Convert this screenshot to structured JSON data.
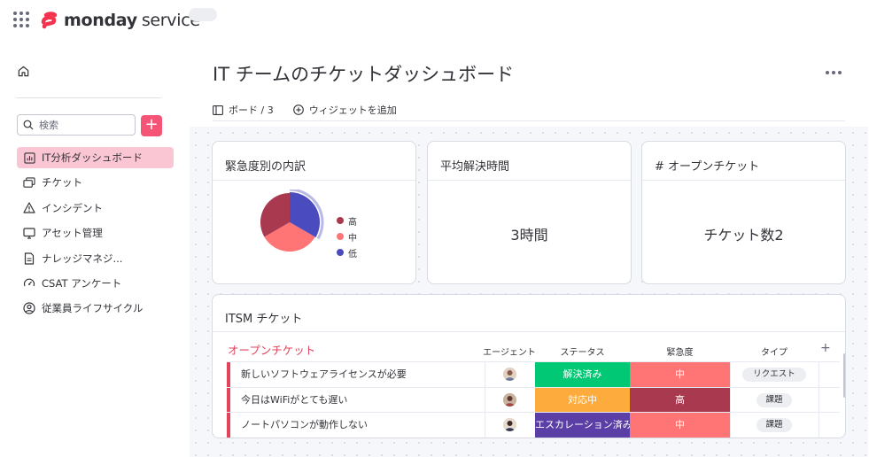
{
  "app": {
    "brand": "monday",
    "product": "service"
  },
  "sidebar": {
    "search_placeholder": "検索",
    "add_label": "+",
    "items": [
      {
        "label": "IT分析ダッシュボード",
        "icon": "chart-icon",
        "active": true
      },
      {
        "label": "チケット",
        "icon": "tickets-icon",
        "active": false
      },
      {
        "label": "インシデント",
        "icon": "warning-icon",
        "active": false
      },
      {
        "label": "アセット管理",
        "icon": "monitor-icon",
        "active": false
      },
      {
        "label": "ナレッジマネジ...",
        "icon": "document-icon",
        "active": false
      },
      {
        "label": "CSAT アンケート",
        "icon": "gauge-icon",
        "active": false
      },
      {
        "label": "従業員ライフサイクル",
        "icon": "user-circle-icon",
        "active": false
      }
    ]
  },
  "main": {
    "title": "IT チームのチケットダッシュボード",
    "boards_label": "ボード / 3",
    "add_widget_label": "ウィジェットを追加"
  },
  "widgets": {
    "urgency_breakdown": {
      "title": "緊急度別の内訳",
      "legend": [
        {
          "label": "高",
          "color": "#a8394f"
        },
        {
          "label": "中",
          "color": "#ff7575"
        },
        {
          "label": "低",
          "color": "#4b4bc0"
        }
      ]
    },
    "avg_resolution": {
      "title": "平均解決時間",
      "value": "3時間"
    },
    "open_tickets": {
      "title": "# オープンチケット",
      "value": "チケット数2"
    }
  },
  "chart_data": {
    "type": "pie",
    "categories": [
      "高",
      "中",
      "低"
    ],
    "values": [
      1,
      1,
      1
    ],
    "colors": [
      "#a8394f",
      "#ff7575",
      "#4b4bc0"
    ],
    "highlighted": "低",
    "legend_position": "right"
  },
  "itsm": {
    "title": "ITSM チケット",
    "group": "オープンチケット",
    "columns": {
      "agent": "エージェント",
      "status": "ステータス",
      "urgency": "緊急度",
      "type": "タイプ",
      "add": "+"
    },
    "rows": [
      {
        "name": "新しいソフトウェアライセンスが必要",
        "status": "解決済み",
        "status_color": "#00c875",
        "urgency": "中",
        "urgency_color": "#ff7575",
        "type": "リクエスト"
      },
      {
        "name": "今日はWiFiがとても遅い",
        "status": "対応中",
        "status_color": "#fdab3d",
        "urgency": "高",
        "urgency_color": "#a8394f",
        "type": "課題"
      },
      {
        "name": "ノートパソコンが動作しない",
        "status": "エスカレーション済み",
        "status_color": "#5b3fa6",
        "urgency": "中",
        "urgency_color": "#ff7575",
        "type": "課題"
      }
    ]
  },
  "colors": {
    "accent": "#f65476",
    "active_nav": "#fbc6d3",
    "group": "#e2445c"
  }
}
